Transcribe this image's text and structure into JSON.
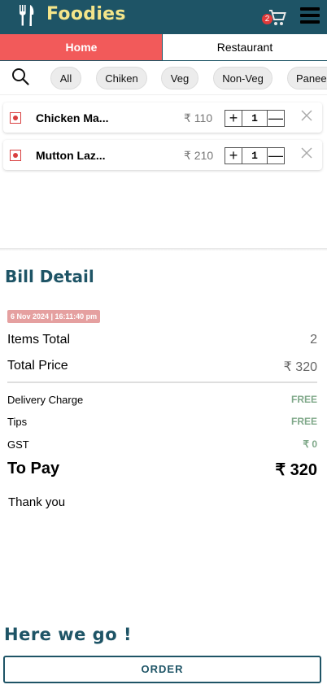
{
  "header": {
    "app_title": "Foodies",
    "logo_icon": "fork-knife-icon",
    "cart_count": "2",
    "cart_icon": "cart-icon",
    "menu_icon": "hamburger-menu-icon",
    "brand_color": "#1e5466",
    "title_color": "#f4e58a"
  },
  "tabs": [
    {
      "label": "Home",
      "active": true
    },
    {
      "label": "Restaurant",
      "active": false
    }
  ],
  "filters": {
    "search_icon": "search-icon",
    "chips": [
      "All",
      "Chiken",
      "Veg",
      "Non-Veg",
      "Paneer"
    ]
  },
  "cart_items": [
    {
      "name": "Chicken Ma...",
      "price": "₹ 110",
      "quantity": "1"
    },
    {
      "name": "Mutton Laz...",
      "price": "₹ 210",
      "quantity": "1"
    }
  ],
  "bill": {
    "title": "Bill Detail",
    "timestamp": "6 Nov 2024 | 16:11:40 pm",
    "items_total_label": "Items Total",
    "items_total_value": "2",
    "total_price_label": "Total Price",
    "total_price_value": "₹ 320",
    "delivery_label": "Delivery Charge",
    "delivery_value": "FREE",
    "tips_label": "Tips",
    "tips_value": "FREE",
    "gst_label": "GST",
    "gst_value": "₹ 0",
    "to_pay_label": "To Pay",
    "to_pay_value": "₹ 320",
    "thanks": "Thank you"
  },
  "footer": {
    "tagline": "Here we go !",
    "order_label": "ORDER"
  },
  "colors": {
    "accent": "#f25a5a",
    "free_green": "#7fa889",
    "veg_mark": "#d94040"
  }
}
